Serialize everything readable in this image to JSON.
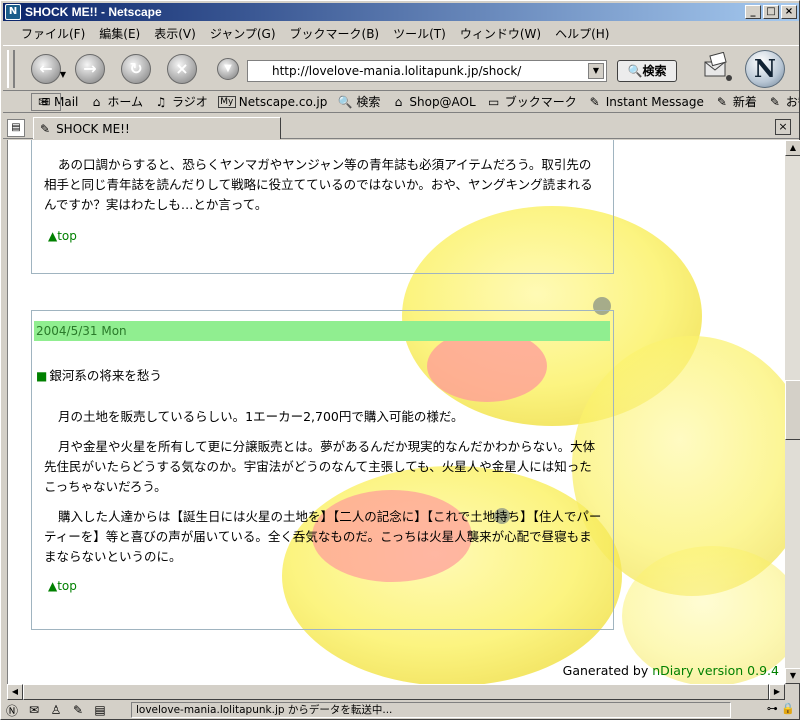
{
  "window": {
    "title": "SHOCK ME!! - Netscape",
    "app_icon": "netscape-icon"
  },
  "menu": {
    "items": [
      "ファイル(F)",
      "編集(E)",
      "表示(V)",
      "ジャンプ(G)",
      "ブックマーク(B)",
      "ツール(T)",
      "ウィンドウ(W)",
      "ヘルプ(H)"
    ]
  },
  "nav": {
    "url": "http://lovelove-mania.lolitapunk.jp/shock/",
    "search_label": "検索"
  },
  "personal_toolbar": {
    "items": [
      {
        "icon": "✉",
        "label": "Mail"
      },
      {
        "icon": "⌂",
        "label": "ホーム"
      },
      {
        "icon": "♫",
        "label": "ラジオ"
      },
      {
        "icon": "My",
        "label": "Netscape.co.jp"
      },
      {
        "icon": "🔍",
        "label": "検索"
      },
      {
        "icon": "⌂",
        "label": "Shop@AOL"
      },
      {
        "icon": "▭",
        "label": "ブックマーク"
      },
      {
        "icon": "✎",
        "label": "Instant Message"
      },
      {
        "icon": "✎",
        "label": "新着"
      },
      {
        "icon": "✎",
        "label": "お勧め"
      }
    ]
  },
  "tab": {
    "label": "SHOCK ME!!"
  },
  "content": {
    "entry1": {
      "paragraphs": [
        "あの口調からすると、恐らくヤンマガやヤンジャン等の青年誌も必須アイテムだろう。取引先の相手と同じ青年誌を読んだりして戦略に役立てているのではないか。おや、ヤングキング読まれるんですか？実はわたしも…とか言って。"
      ],
      "top_link": "▲top"
    },
    "entry2": {
      "date": "2004/5/31 Mon",
      "heading_marker": "■",
      "heading": "銀河系の将来を愁う",
      "paragraphs": [
        "月の土地を販売しているらしい。1エーカー2,700円で購入可能の様だ。",
        "月や金星や火星を所有して更に分譲販売とは。夢があるんだか現実的なんだかわからない。大体先住民がいたらどうする気なのか。宇宙法がどうのなんて主張しても、火星人や金星人には知ったこっちゃないだろう。",
        "購入した人達からは【誕生日には火星の土地を】【二人の記念に】【これで土地持ち】【住人でパーティーを】等と喜びの声が届いている。全く呑気なものだ。こっちは火星人襲来が心配で昼寝もままならないというのに。"
      ],
      "top_link": "▲top"
    },
    "footer": {
      "prefix": "Ganerated by ",
      "link": "nDiary version 0.9.4"
    }
  },
  "status": {
    "text": "lovelove-mania.lolitapunk.jp からデータを転送中..."
  }
}
